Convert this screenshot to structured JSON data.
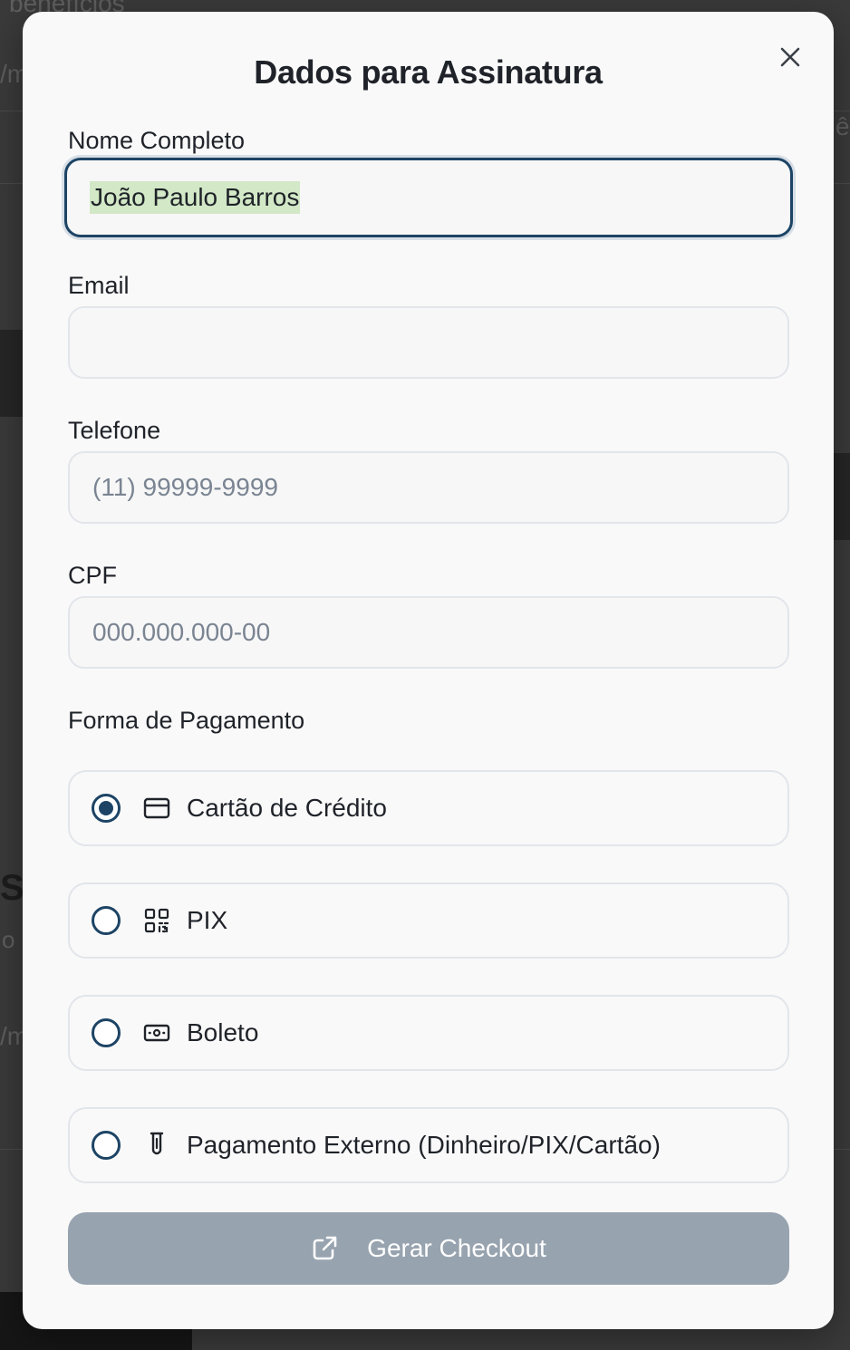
{
  "modal": {
    "title": "Dados para Assinatura",
    "close_icon": "close-icon"
  },
  "form": {
    "name": {
      "label": "Nome Completo",
      "value": "João Paulo Barros"
    },
    "email": {
      "label": "Email",
      "value": "",
      "placeholder": ""
    },
    "phone": {
      "label": "Telefone",
      "value": "",
      "placeholder": "(11) 99999-9999"
    },
    "cpf": {
      "label": "CPF",
      "value": "",
      "placeholder": "000.000.000-00"
    }
  },
  "payment": {
    "label": "Forma de Pagamento",
    "selected": "Cartão de Crédito",
    "options": [
      {
        "label": "Cartão de Crédito",
        "icon": "credit-card-icon",
        "checked": true
      },
      {
        "label": "PIX",
        "icon": "qr-code-icon",
        "checked": false
      },
      {
        "label": "Boleto",
        "icon": "banknote-icon",
        "checked": false
      },
      {
        "label": "Pagamento Externo (Dinheiro/PIX/Cartão)",
        "icon": "external-payment-icon",
        "checked": false
      }
    ]
  },
  "submit": {
    "label": "Gerar Checkout",
    "icon": "external-link-icon"
  },
  "background": {
    "fragments": [
      "benefícios",
      "/m",
      "ê",
      "S",
      "o",
      "/m"
    ]
  },
  "colors": {
    "accent": "#1d4465",
    "button_disabled": "#97a3af",
    "overlay": "#3a3a3a",
    "selection": "#d2e8c6"
  }
}
